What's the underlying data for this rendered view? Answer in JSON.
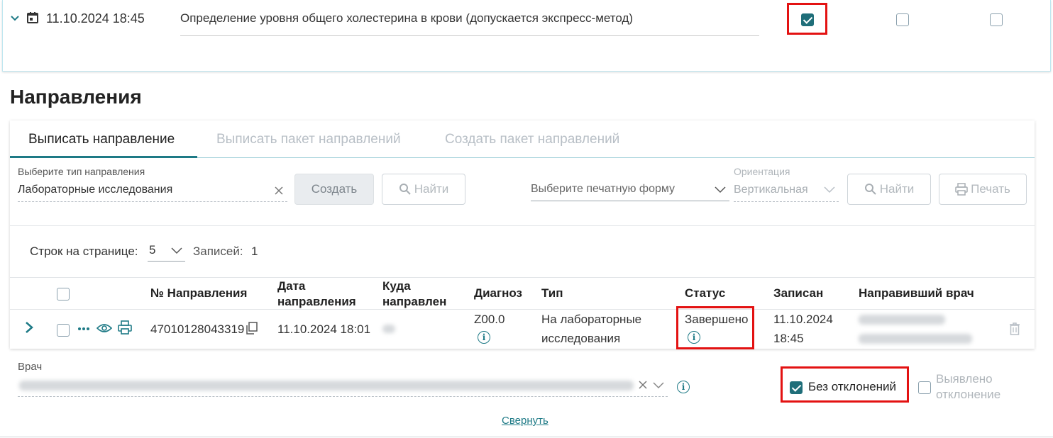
{
  "service_row": {
    "date": "11.10.2024 18:45",
    "name": "Определение уровня общего холестерина в крови (допускается экспресс-метод)",
    "checkboxes": [
      true,
      false,
      false
    ]
  },
  "section": {
    "title": "Направления"
  },
  "tabs": [
    {
      "label": "Выписать направление",
      "active": true
    },
    {
      "label": "Выписать пакет направлений",
      "active": false
    },
    {
      "label": "Создать пакет направлений",
      "active": false
    }
  ],
  "form": {
    "type_label": "Выберите тип направления",
    "type_value": "Лабораторные исследования",
    "create_button": "Создать",
    "find_button": "Найти",
    "print_form_placeholder": "Выберите печатную форму",
    "orientation_label": "Ориентация",
    "orientation_value": "Вертикальная",
    "find_button_2": "Найти",
    "print_button": "Печать"
  },
  "pager": {
    "rows_label": "Строк на странице:",
    "rows_value": "5",
    "records_label": "Записей:",
    "records_value": "1"
  },
  "table": {
    "headers": {
      "number": "№ Направления",
      "date_line1": "Дата",
      "date_line2": "направления",
      "where_line1": "Куда",
      "where_line2": "направлен",
      "diagnosis": "Диагноз",
      "type": "Тип",
      "status": "Статус",
      "recorded": "Записан",
      "doctor": "Направивший врач"
    },
    "row": {
      "number": "47010128043319",
      "date": "11.10.2024 18:01",
      "diagnosis": "Z00.0",
      "type_line1": "На лабораторные",
      "type_line2": "исследования",
      "status": "Завершено",
      "recorded_line1": "11.10.2024",
      "recorded_line2": "18:45"
    }
  },
  "doctor_field": {
    "label": "Врач"
  },
  "result": {
    "no_deviation": "Без отклонений",
    "no_deviation_checked": true,
    "deviation_line1": "Выявлено",
    "deviation_line2": "отклонение",
    "deviation_checked": false
  },
  "collapse_link": "Свернуть",
  "colors": {
    "accent": "#1e7a86",
    "highlight": "#e31212",
    "check": "#1f6e79"
  }
}
